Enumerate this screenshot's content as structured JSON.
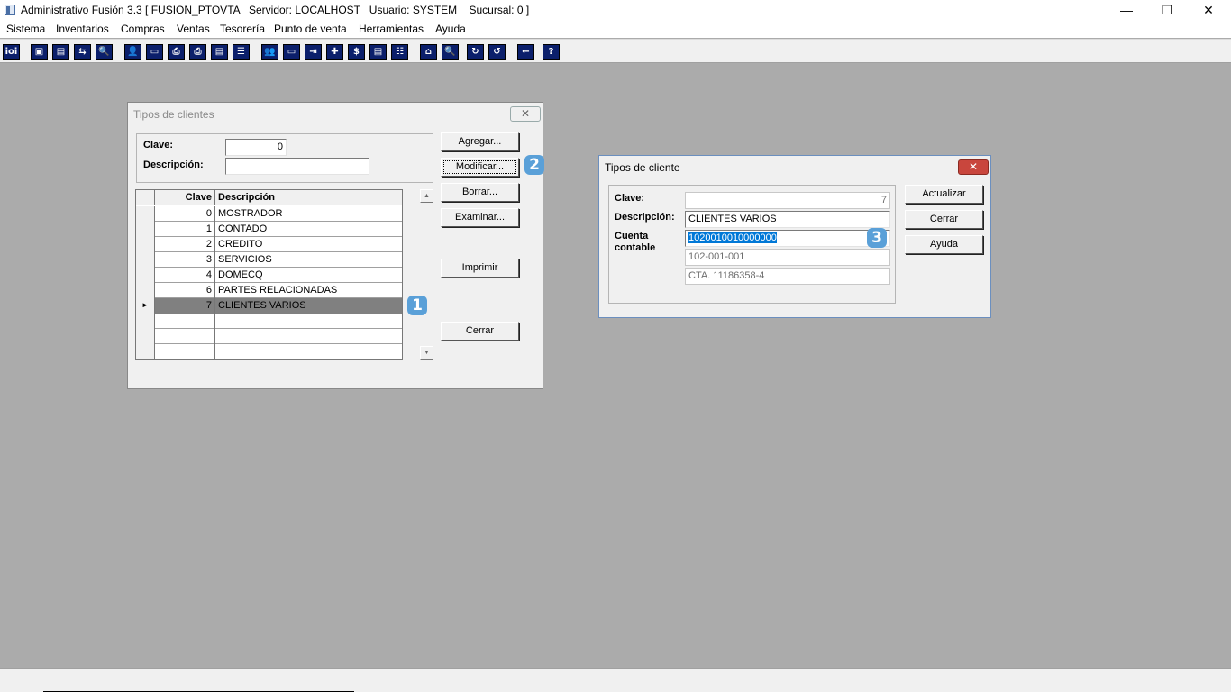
{
  "window": {
    "title": "Administrativo Fusión 3.3 [ FUSION_PTOVTA   Servidor: LOCALHOST   Usuario: SYSTEM    Sucursal: 0 ]",
    "minimize": "—",
    "restore": "❐",
    "close": "✕"
  },
  "menu": [
    "Sistema",
    "Inventarios",
    "Compras",
    "Ventas",
    "Tesorería",
    "Punto de venta",
    "Herramientas",
    "Ayuda"
  ],
  "toolbar": {
    "icons": [
      "ioi-icon",
      "window-icon",
      "trash-icon",
      "arrows-icon",
      "search-icon",
      "user-icon",
      "folder-icon",
      "print-out-icon",
      "print-icon",
      "doc-icon",
      "list-icon",
      "people-icon",
      "folder2-icon",
      "export-icon",
      "add-icon",
      "dollar-icon",
      "report-icon",
      "table-icon",
      "home-icon",
      "zoom-icon",
      "refresh-icon",
      "undo-icon",
      "back-icon",
      "help-icon"
    ],
    "glyphs": [
      "ioi",
      "▣",
      "▤",
      "⇆",
      "🔍",
      "👤",
      "▭",
      "⎙",
      "⎙",
      "▤",
      "☰",
      "👥",
      "▭",
      "⇥",
      "✚",
      "$",
      "▤",
      "☷",
      "⌂",
      "🔍",
      "↻",
      "↺",
      "←",
      "?"
    ]
  },
  "list_dialog": {
    "title": "Tipos de clientes",
    "close": "✕",
    "clave_label": "Clave:",
    "clave_value": "0",
    "descripcion_label": "Descripción:",
    "descripcion_value": "",
    "grid_headers": {
      "clave": "Clave",
      "descripcion": "Descripción"
    },
    "rows": [
      {
        "clave": "0",
        "descripcion": "MOSTRADOR"
      },
      {
        "clave": "1",
        "descripcion": "CONTADO"
      },
      {
        "clave": "2",
        "descripcion": "CREDITO"
      },
      {
        "clave": "3",
        "descripcion": "SERVICIOS"
      },
      {
        "clave": "4",
        "descripcion": "DOMECQ"
      },
      {
        "clave": "6",
        "descripcion": "PARTES RELACIONADAS"
      },
      {
        "clave": "7",
        "descripcion": "CLIENTES VARIOS"
      }
    ],
    "selected_marker": "►",
    "buttons": {
      "agregar": "Agregar...",
      "modificar": "Modificar...",
      "borrar": "Borrar...",
      "examinar": "Examinar...",
      "imprimir": "Imprimir",
      "cerrar": "Cerrar"
    }
  },
  "edit_dialog": {
    "title": "Tipos de cliente",
    "close": "✕",
    "clave_label": "Clave:",
    "clave_value": "7",
    "descripcion_label": "Descripción:",
    "descripcion_value": "CLIENTES VARIOS",
    "cuenta_label_1": "Cuenta",
    "cuenta_label_2": "contable",
    "cuenta_value": "1020010010000000",
    "cuenta_sub1": "102-001-001",
    "cuenta_sub2": "CTA. 11186358-4",
    "buttons": {
      "actualizar": "Actualizar",
      "cerrar": "Cerrar",
      "ayuda": "Ayuda"
    }
  },
  "badges": {
    "b1": "1",
    "b2": "2",
    "b3": "3"
  },
  "colors": {
    "toolbar_button": "#0b1f6b",
    "badge": "#5aa0d8",
    "selection": "#0078d7",
    "desktop": "#ababab"
  }
}
